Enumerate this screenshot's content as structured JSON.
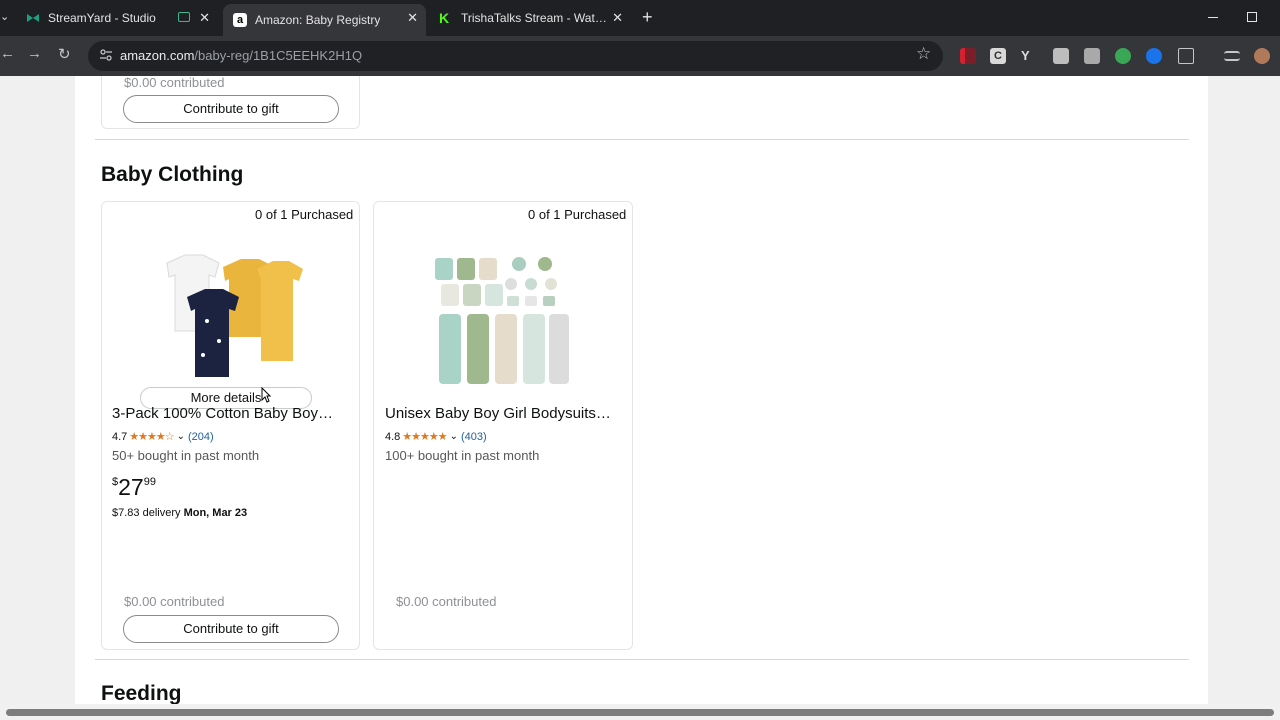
{
  "browser": {
    "tabs": [
      {
        "title": "StreamYard - Studio",
        "favicon_color": "#1d9f82",
        "icon": "streamyard-icon"
      },
      {
        "title": "Amazon: Baby Registry",
        "favicon_color": "#ffffff",
        "icon": "amazon-icon"
      },
      {
        "title": "TrishaTalks Stream - Watch Live",
        "favicon_color": "#53fc18",
        "icon": "kick-icon"
      }
    ],
    "url_domain": "amazon.com",
    "url_path": "/baby-reg/1B1C5EEHK2H1Q",
    "new_tab_label": "+"
  },
  "top_card": {
    "contributed": "$0.00 contributed",
    "button": "Contribute to gift"
  },
  "section": {
    "title": "Baby Clothing",
    "next_title": "Feeding"
  },
  "products": [
    {
      "purchased": "0 of 1 Purchased",
      "title": "3-Pack 100% Cotton Baby Boy…",
      "rating": "4.7",
      "stars": "★★★★☆",
      "reviews": "(204)",
      "bought": "50+ bought in past month",
      "price_symbol": "$",
      "price_whole": "27",
      "price_fraction": "99",
      "delivery_cost": "$7.83 delivery",
      "delivery_date": "Mon, Mar 23",
      "contributed": "$0.00 contributed",
      "button": "Contribute to gift",
      "more_details": "More details"
    },
    {
      "purchased": "0 of 1 Purchased",
      "title": "Unisex Baby Boy Girl Bodysuits…",
      "rating": "4.8",
      "stars": "★★★★★",
      "reviews": "(403)",
      "bought": "100+ bought in past month",
      "contributed": "$0.00 contributed"
    }
  ]
}
